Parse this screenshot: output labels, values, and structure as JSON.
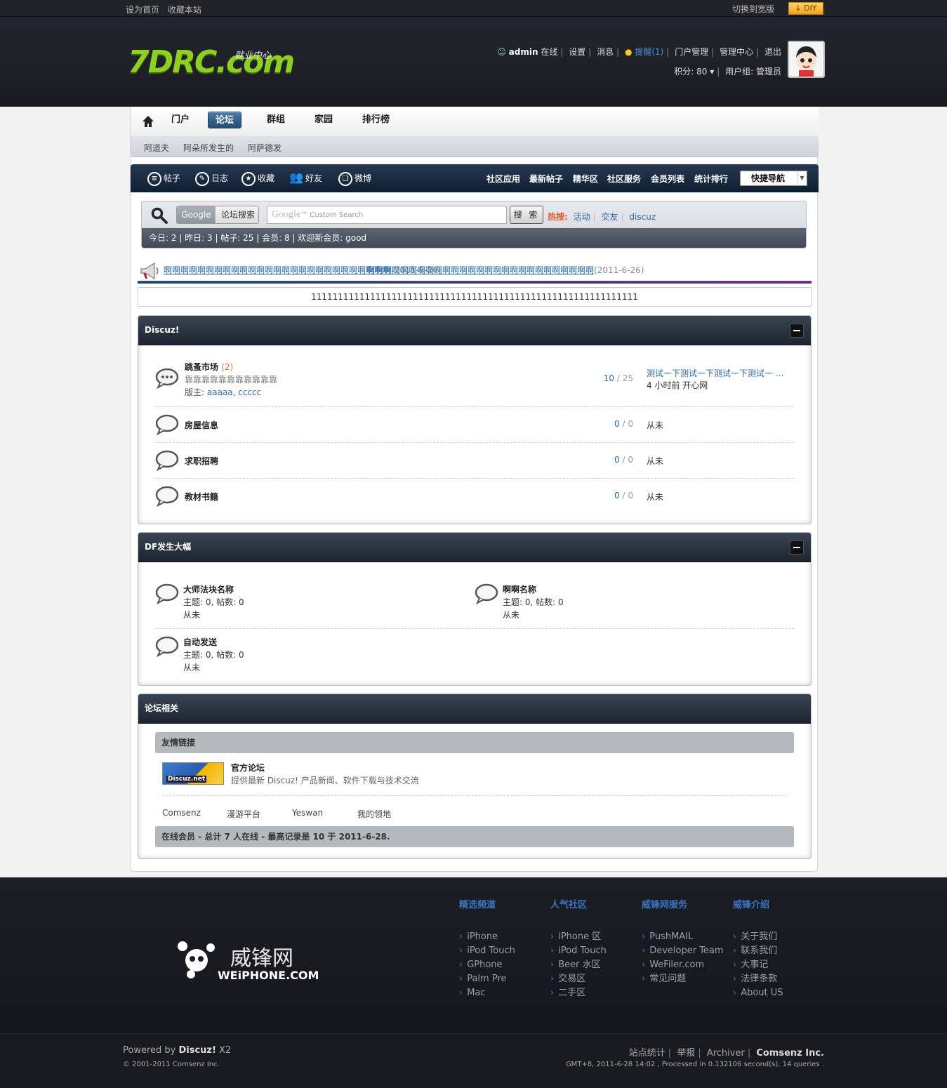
{
  "topbar": {
    "set_home": "设为首页",
    "bookmark": "收藏本站",
    "wide": "切换到宽版",
    "diy": "DIY"
  },
  "logo": {
    "text": "7DRC.com",
    "sub": "就业中心"
  },
  "user": {
    "name": "admin",
    "status": "在线",
    "settings": "设置",
    "messages": "消息",
    "alert": "提醒(1)",
    "portal_admin": "门户管理",
    "admin_center": "管理中心",
    "logout": "退出",
    "points": "积分: 80",
    "group": "用户组: 管理员"
  },
  "nav": {
    "items": [
      "门户",
      "论坛",
      "群组",
      "家园",
      "排行榜"
    ],
    "active": "论坛"
  },
  "subnav": [
    "阿道夫",
    "阿朵所发生的",
    "阿萨德发"
  ],
  "toolbar": {
    "left": [
      "帖子",
      "日志",
      "收藏",
      "好友",
      "微博"
    ],
    "right": [
      "社区应用",
      "最新帖子",
      "精华区",
      "社区服务",
      "会员列表",
      "统计排行"
    ],
    "quick": "快捷导航"
  },
  "search": {
    "tab_google": "Google",
    "tab_forum": "论坛搜索",
    "placeholder_logo": "Google",
    "placeholder": "Custom Search",
    "button": "搜 索",
    "hot_label": "热搜:",
    "hot": [
      "活动",
      "交友",
      "discuz"
    ]
  },
  "stats": "今日: 2  |  昨日: 3  |  帖子: 25  |  会员: 8  |  欢迎新会员: good",
  "announcements": [
    {
      "title": "啊啊啊啊啊啊啊啊啊啊啊啊啊啊啊啊啊啊啊啊啊啊啊啊啊啊啊",
      "date": "(2011-6-26)"
    },
    {
      "title": "啊啊啊啊啊啊啊啊啊啊啊啊啊啊啊啊啊啊啊啊啊啊啊啊啊啊啊",
      "date": "(2011-6-26)"
    }
  ],
  "notice": "1111111111111111111111111111111111111111111111111111111111111",
  "cat1": {
    "title": "Discuz!",
    "forums": [
      {
        "name": "跳蚤市场",
        "new": "(2)",
        "desc": "靠靠靠靠靠靠靠靠靠靠靠",
        "mod_label": "版主:",
        "mods": "aaaaa, ccccc",
        "threads": "10",
        "posts": "25",
        "last_title": "测试一下测试一下测试一下测试一 ...",
        "last_info": "4 小时前 开心网"
      },
      {
        "name": "房屋信息",
        "threads": "0",
        "posts": "0",
        "last_info": "从未"
      },
      {
        "name": "求职招聘",
        "threads": "0",
        "posts": "0",
        "last_info": "从未"
      },
      {
        "name": "教材书籍",
        "threads": "0",
        "posts": "0",
        "last_info": "从未"
      }
    ]
  },
  "cat2": {
    "title": "DF发生大幅",
    "forums": [
      {
        "name": "大师法块名称",
        "stats": "主题: 0, 帖数: 0",
        "last": "从未"
      },
      {
        "name": "啊啊名称",
        "stats": "主题: 0, 帖数: 0",
        "last": "从未"
      },
      {
        "name": "自动发送",
        "stats": "主题: 0, 帖数: 0",
        "last": "从未"
      }
    ]
  },
  "cat3": {
    "title": "论坛相关",
    "links_header": "友情链接",
    "dz_logo": "Discuz.net",
    "dz_title": "官方论坛",
    "dz_desc": "提供最新 Discuz! 产品新闻、软件下载与技术交流",
    "text_links": [
      "Comsenz",
      "漫游平台",
      "Yeswan",
      "我的领地"
    ],
    "online": "在线会员 - 总计 7 人在线 - 最高记录是 10 于 2011-6-28."
  },
  "footer": {
    "logo_cn": "威锋网",
    "logo_en": "WEiPHONE.COM",
    "cols": [
      {
        "title": "精选频道",
        "items": [
          "iPhone",
          "iPod Touch",
          "GPhone",
          "Palm Pre",
          "Mac"
        ]
      },
      {
        "title": "人气社区",
        "items": [
          "iPhone 区",
          "iPod Touch",
          "Beer 水区",
          "交易区",
          "二手区"
        ]
      },
      {
        "title": "威锋网服务",
        "items": [
          "PushMAIL",
          "Developer Team",
          "WeFiler.com",
          "常见问题"
        ]
      },
      {
        "title": "威锋介绍",
        "items": [
          "关于我们",
          "联系我们",
          "大事记",
          "法律条款",
          "About US"
        ]
      }
    ]
  },
  "bottom": {
    "powered_pre": "Powered by ",
    "powered_brand": "Discuz!",
    "powered_ver": " X2",
    "copyright": "© 2001-2011 Comsenz Inc.",
    "links": [
      "站点统计",
      "举报",
      "Archiver"
    ],
    "company": "Comsenz Inc.",
    "gmt": "GMT+8, 2011-6-28 14:02 , Processed in 0.132106 second(s), 14 queries ."
  }
}
